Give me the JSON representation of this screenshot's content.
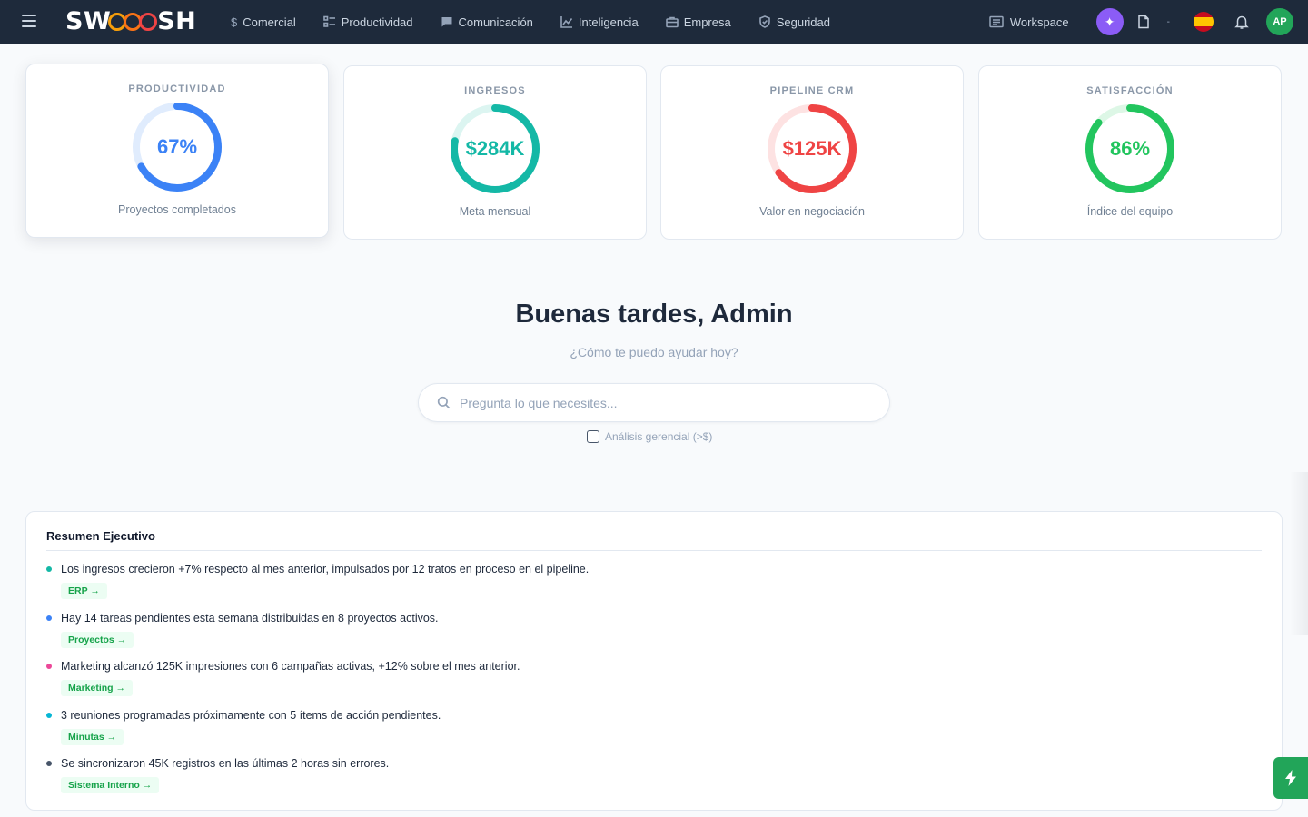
{
  "brand": {
    "logo_prefix": "SW",
    "logo_suffix": "SH"
  },
  "nav": {
    "items": [
      {
        "label": "Comercial",
        "icon": "dollar-icon"
      },
      {
        "label": "Productividad",
        "icon": "checklist-icon"
      },
      {
        "label": "Comunicación",
        "icon": "chat-icon"
      },
      {
        "label": "Inteligencia",
        "icon": "chart-line-icon"
      },
      {
        "label": "Empresa",
        "icon": "briefcase-icon"
      },
      {
        "label": "Seguridad",
        "icon": "shield-icon"
      }
    ],
    "workspace_label": "Workspace",
    "dropdown_marker": "-",
    "avatar_initials": "AP",
    "flag": "spain-flag-icon"
  },
  "kpis": [
    {
      "label": "PRODUCTIVIDAD",
      "value": "67%",
      "subtitle": "Proyectos completados",
      "fraction": 0.67,
      "color": "#3b82f6",
      "track": "#e0ecfd"
    },
    {
      "label": "INGRESOS",
      "value": "$284K",
      "subtitle": "Meta mensual",
      "fraction": 0.78,
      "color": "#14b8a6",
      "track": "#dcf5f1"
    },
    {
      "label": "PIPELINE CRM",
      "value": "$125K",
      "subtitle": "Valor en negociación",
      "fraction": 0.65,
      "color": "#ef4444",
      "track": "#fde2e2"
    },
    {
      "label": "SATISFACCIÓN",
      "value": "86%",
      "subtitle": "Índice del equipo",
      "fraction": 0.86,
      "color": "#22c55e",
      "track": "#ddf7e6"
    }
  ],
  "greeting": {
    "title": "Buenas tardes, Admin",
    "subtitle": "¿Cómo te puedo ayudar hoy?",
    "search_placeholder": "Pregunta lo que necesites...",
    "checkbox_label": "Análisis gerencial (>$)"
  },
  "summary": {
    "title": "Resumen Ejecutivo",
    "items": [
      {
        "text": "Los ingresos crecieron +7% respecto al mes anterior, impulsados por 12 tratos en proceso en el pipeline.",
        "tag": "ERP →",
        "dot": "#14b8a6"
      },
      {
        "text": "Hay 14 tareas pendientes esta semana distribuidas en 8 proyectos activos.",
        "tag": "Proyectos →",
        "dot": "#3b82f6"
      },
      {
        "text": "Marketing alcanzó 125K impresiones con 6 campañas activas, +12% sobre el mes anterior.",
        "tag": "Marketing →",
        "dot": "#ec4899"
      },
      {
        "text": "3 reuniones programadas próximamente con 5 ítems de acción pendientes.",
        "tag": "Minutas →",
        "dot": "#06b6d4"
      },
      {
        "text": "Se sincronizaron 45K registros en las últimas 2 horas sin errores.",
        "tag": "Sistema Interno →",
        "dot": "#475569"
      }
    ]
  },
  "colors": {
    "nav_bg": "#1e2a3b",
    "accent_green": "#22a559",
    "ai_purple": "#8b5cf6"
  }
}
